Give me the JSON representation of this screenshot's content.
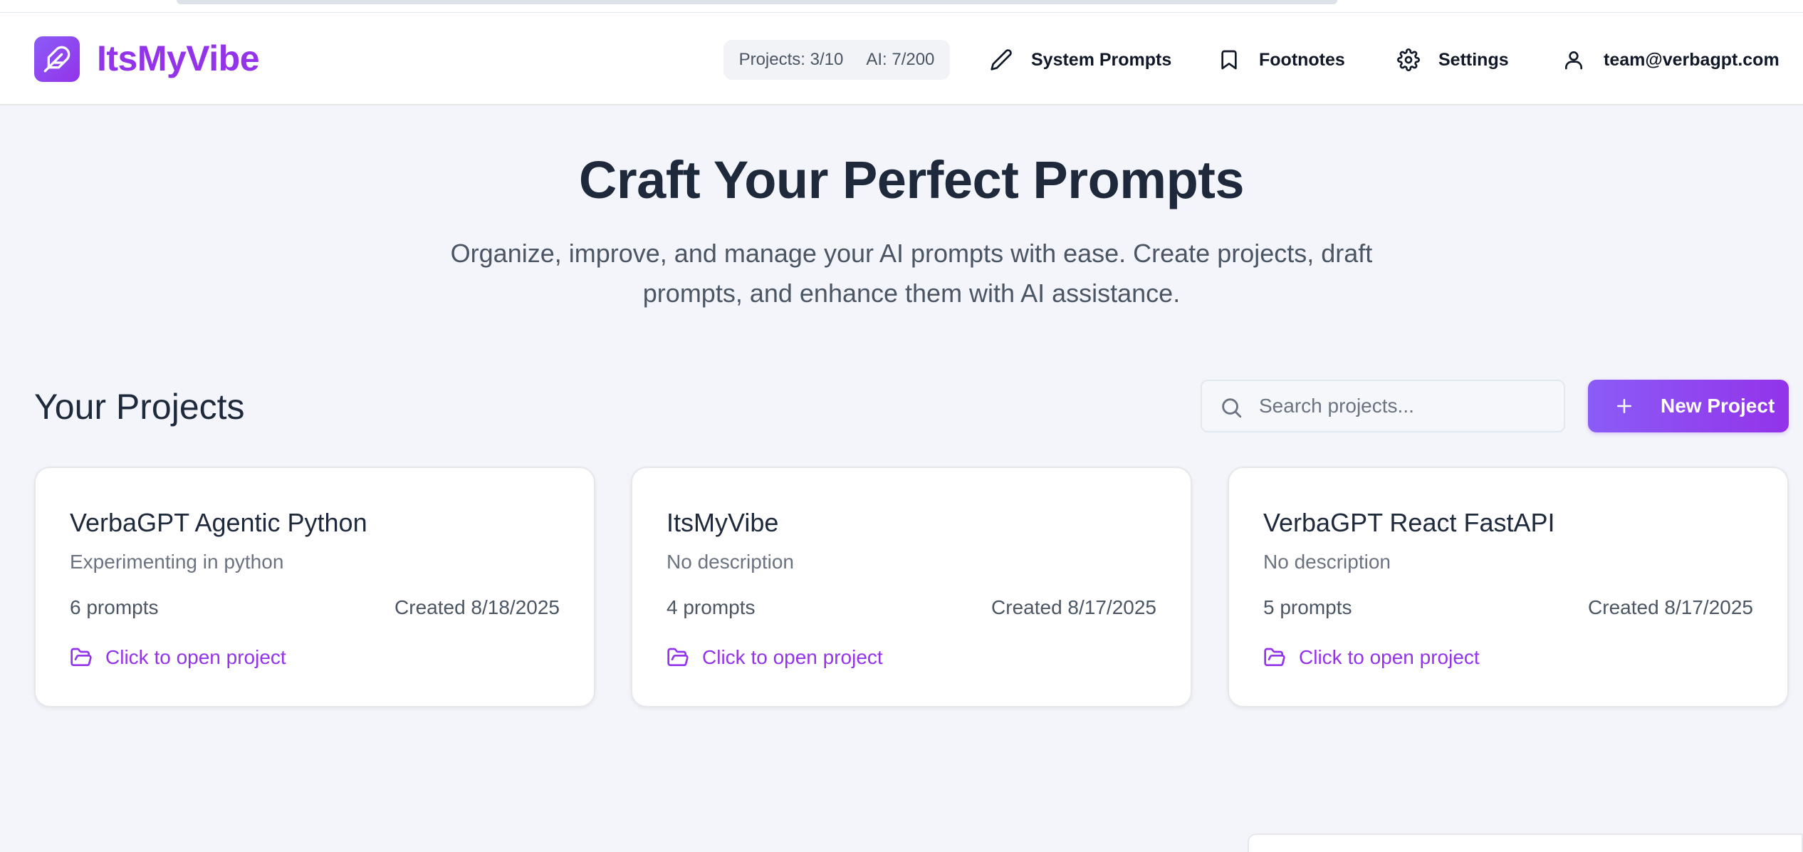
{
  "brand": {
    "name": "ItsMyVibe",
    "logo_icon": "feather-icon",
    "accent_color": "#9333ea"
  },
  "header": {
    "usage": {
      "projects": "Projects: 3/10",
      "ai": "AI: 7/200"
    },
    "nav": {
      "system_prompts": {
        "label": "System Prompts",
        "icon": "pencil-icon"
      },
      "footnotes": {
        "label": "Footnotes",
        "icon": "bookmark-icon"
      },
      "settings": {
        "label": "Settings",
        "icon": "gear-icon"
      },
      "account": {
        "label": "team@verbagpt.com",
        "icon": "user-icon"
      }
    }
  },
  "hero": {
    "title": "Craft Your Perfect Prompts",
    "subtitle": "Organize, improve, and manage your AI prompts with ease. Create projects, draft prompts, and enhance them with AI assistance."
  },
  "projects_section": {
    "title": "Your Projects",
    "search": {
      "placeholder": "Search projects...",
      "value": ""
    },
    "new_button": {
      "label": "New Project",
      "icon": "plus-icon"
    }
  },
  "projects": [
    {
      "title": "VerbaGPT Agentic Python",
      "description": "Experimenting in python",
      "prompts": "6 prompts",
      "created": "Created 8/18/2025",
      "open_label": "Click to open project"
    },
    {
      "title": "ItsMyVibe",
      "description": "No description",
      "prompts": "4 prompts",
      "created": "Created 8/17/2025",
      "open_label": "Click to open project"
    },
    {
      "title": "VerbaGPT React FastAPI",
      "description": "No description",
      "prompts": "5 prompts",
      "created": "Created 8/17/2025",
      "open_label": "Click to open project"
    }
  ]
}
